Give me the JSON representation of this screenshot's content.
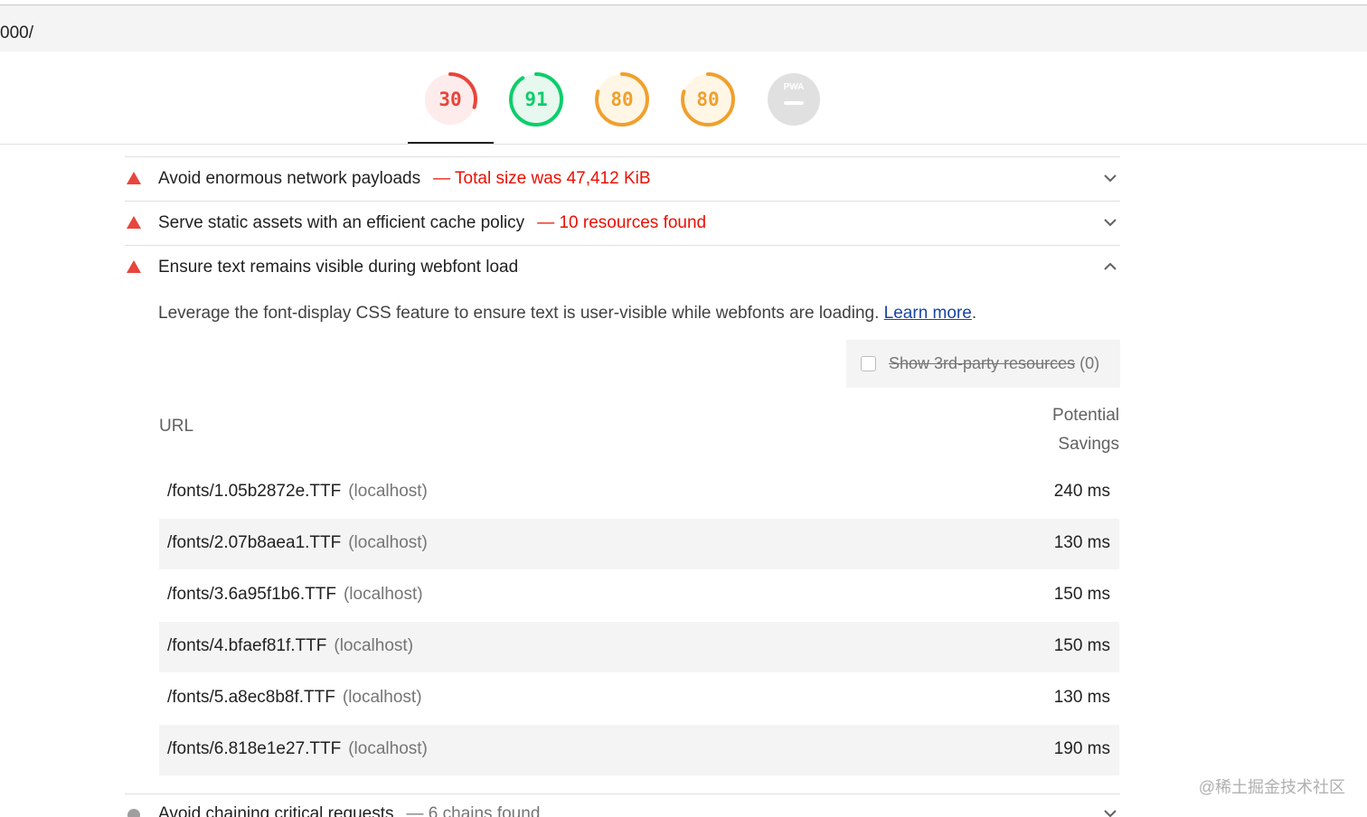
{
  "address_bar": {
    "url": "000/"
  },
  "gauges": [
    {
      "score": "30",
      "fraction": 0.3,
      "color": "#e8453c",
      "bg": "#fdeceb"
    },
    {
      "score": "91",
      "fraction": 0.91,
      "color": "#0cce6b",
      "bg": "#e7f8ee"
    },
    {
      "score": "80",
      "fraction": 0.8,
      "color": "#f0a02d",
      "bg": "#fff6e6"
    },
    {
      "score": "80",
      "fraction": 0.8,
      "color": "#f0a02d",
      "bg": "#fff6e6"
    }
  ],
  "pwa_gauge": {
    "label": "PWA",
    "bg": "#e0e0e0"
  },
  "audits": [
    {
      "title": "Avoid enormous network payloads",
      "display_value": "— Total size was 47,412 KiB",
      "expanded": false
    },
    {
      "title": "Serve static assets with an efficient cache policy",
      "display_value": "— 10 resources found",
      "expanded": false
    },
    {
      "title": "Ensure text remains visible during webfont load",
      "display_value": "",
      "expanded": true
    }
  ],
  "expanded_audit": {
    "description": "Leverage the font-display CSS feature to ensure text is user-visible while webfonts are loading.",
    "learn_more": "Learn more",
    "third_party": {
      "label": "Show 3rd-party resources",
      "count": "(0)",
      "checked": false
    },
    "table": {
      "col_url": "URL",
      "col_savings_1": "Potential",
      "col_savings_2": "Savings",
      "rows": [
        {
          "url": "/fonts/1.05b2872e.TTF",
          "host": "(localhost)",
          "savings": "240 ms"
        },
        {
          "url": "/fonts/2.07b8aea1.TTF",
          "host": "(localhost)",
          "savings": "130 ms"
        },
        {
          "url": "/fonts/3.6a95f1b6.TTF",
          "host": "(localhost)",
          "savings": "150 ms"
        },
        {
          "url": "/fonts/4.bfaef81f.TTF",
          "host": "(localhost)",
          "savings": "150 ms"
        },
        {
          "url": "/fonts/5.a8ec8b8f.TTF",
          "host": "(localhost)",
          "savings": "130 ms"
        },
        {
          "url": "/fonts/6.818e1e27.TTF",
          "host": "(localhost)",
          "savings": "190 ms"
        }
      ]
    }
  },
  "next_audit": {
    "title": "Avoid chaining critical requests",
    "display_value": "— 6 chains found"
  },
  "watermark": "@稀土掘金技术社区",
  "icons": {
    "fail": "triangle-icon",
    "expand": "chevron-down-icon",
    "collapse": "chevron-up-icon",
    "info": "circle-icon"
  }
}
